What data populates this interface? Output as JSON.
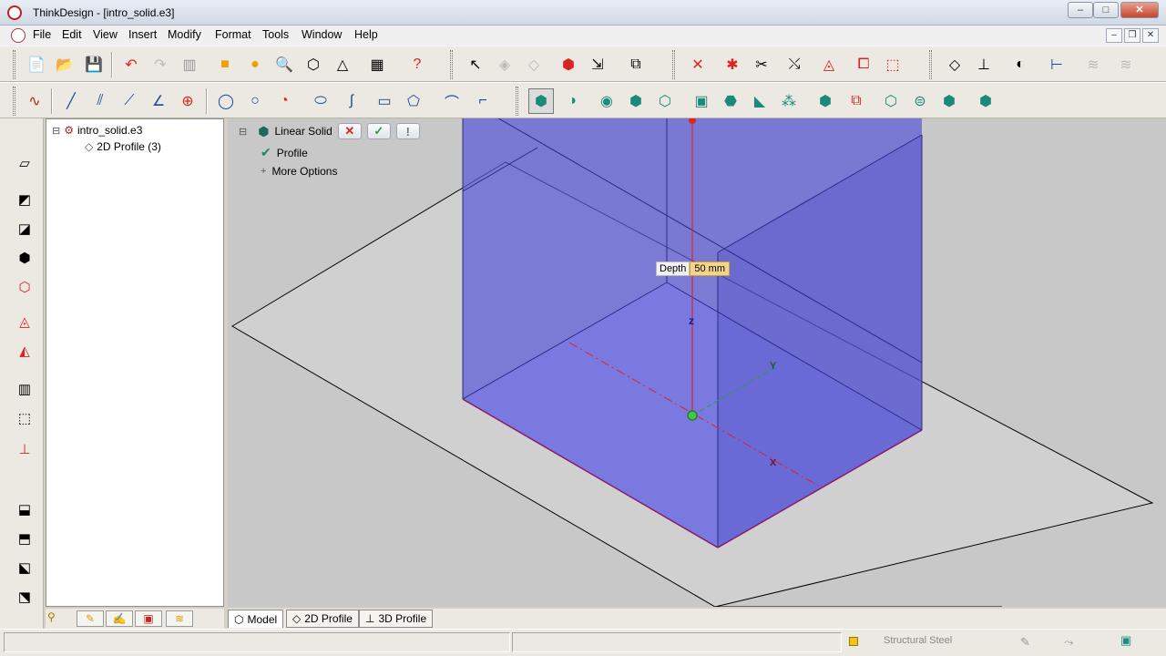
{
  "window": {
    "title": "ThinkDesign  - [intro_solid.e3]",
    "controls": {
      "minimize": "–",
      "maximize": "□",
      "close": "✕"
    }
  },
  "menu": {
    "items": [
      "File",
      "Edit",
      "View",
      "Insert",
      "Modify",
      "Format",
      "Tools",
      "Window",
      "Help"
    ],
    "mdi_controls": {
      "minimize": "–",
      "restore": "❐",
      "close": "✕"
    }
  },
  "tree": {
    "root_label": "intro_solid.e3",
    "root_toggle": "⊟",
    "child_label": "2D Profile (3)"
  },
  "command_panel": {
    "toggle": "⊟",
    "title": "Linear Solid",
    "cancel_icon": "✕",
    "ok_icon": "✓",
    "info_icon": "!",
    "profile_label": "Profile",
    "more_toggle": "+",
    "more_options_label": "More Options"
  },
  "viewport": {
    "depth_label": "Depth",
    "depth_value": "50 mm",
    "axis_x": "x",
    "axis_y": "Y",
    "axis_z": "z"
  },
  "tabs": [
    {
      "icon": "⬡",
      "label": "Model"
    },
    {
      "icon": "◇",
      "label": "2D Profile"
    },
    {
      "icon": "⊥",
      "label": "3D Profile"
    }
  ],
  "status": {
    "material": "Structural Steel",
    "material_color": "#f0c419"
  },
  "colors": {
    "solid_fill": "#6b6be0",
    "accent_red": "#e02424"
  }
}
